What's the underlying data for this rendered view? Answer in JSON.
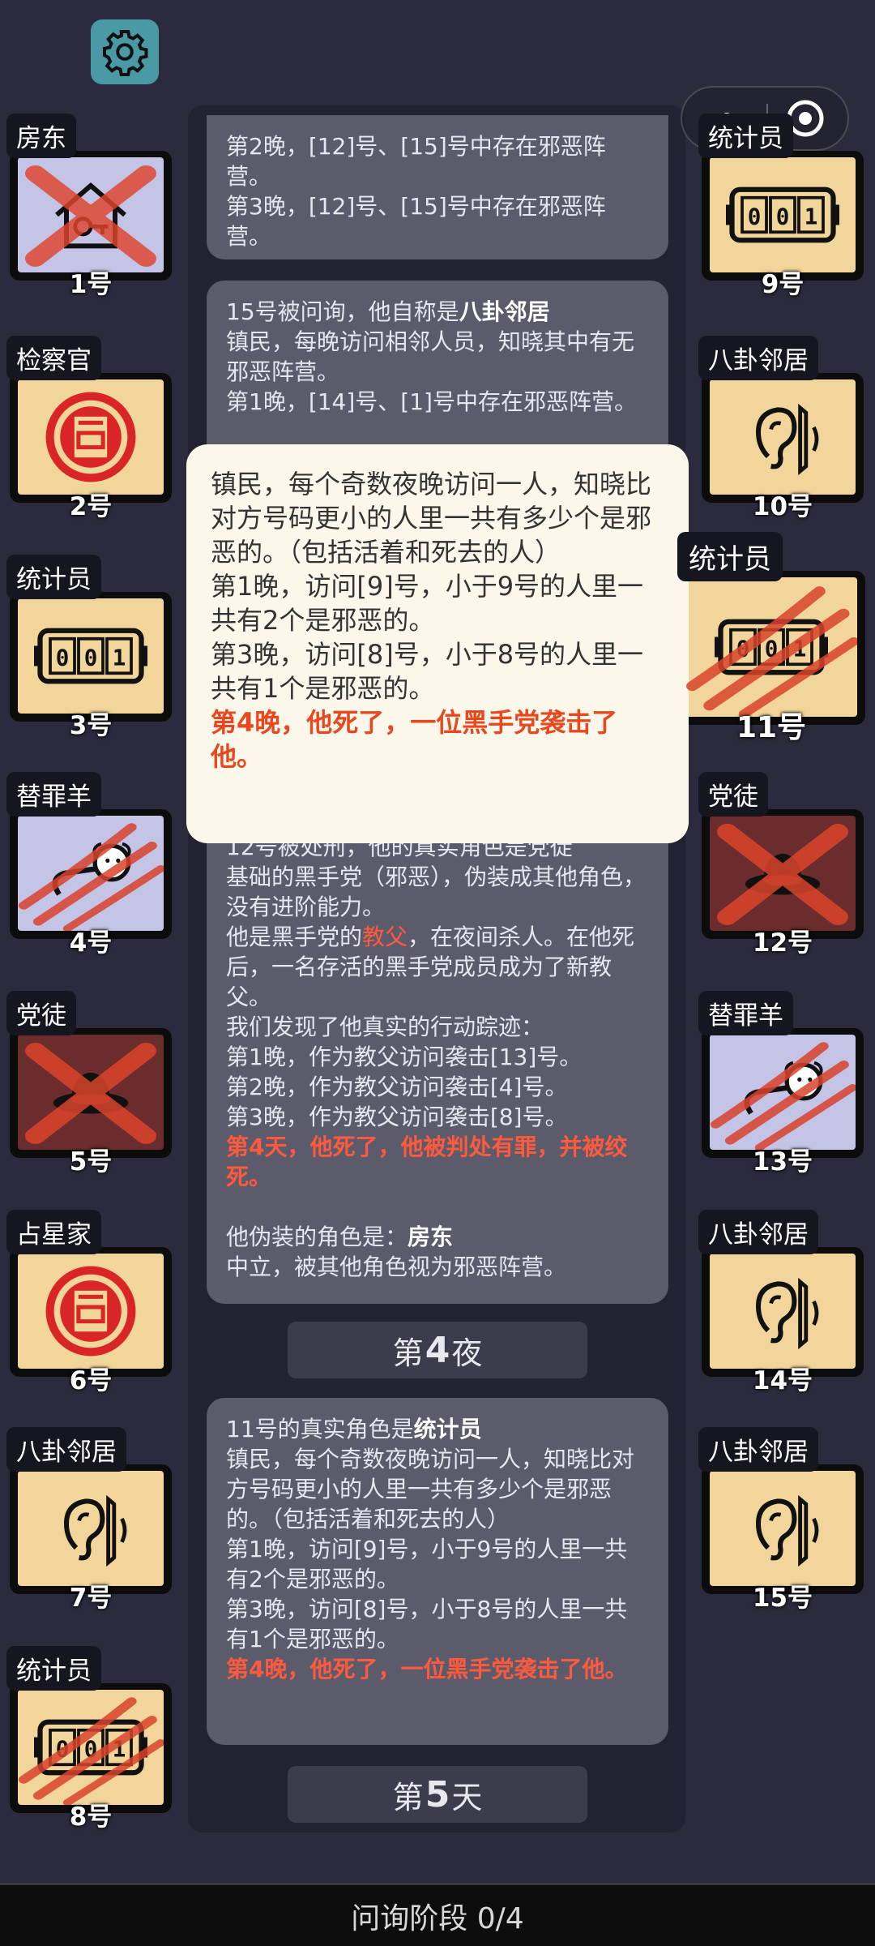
{
  "header": {
    "settings_icon": "gear-icon",
    "menu_icon": "more-dots-icon",
    "close_icon": "target-circle-icon"
  },
  "players_left": [
    {
      "role": "房东",
      "num": "1号",
      "icon": "house-key-icon",
      "state": "crossed",
      "bg": "lavender"
    },
    {
      "role": "检察官",
      "num": "2号",
      "icon": "stamp-icon",
      "state": "alive",
      "bg": "yellow"
    },
    {
      "role": "统计员",
      "num": "3号",
      "icon": "counter-icon",
      "state": "alive",
      "bg": "yellow"
    },
    {
      "role": "替罪羊",
      "num": "4号",
      "icon": "sheep-icon",
      "state": "clawed",
      "bg": "lavender"
    },
    {
      "role": "党徒",
      "num": "5号",
      "icon": "hat-icon",
      "state": "crossed",
      "bg": "dark"
    },
    {
      "role": "占星家",
      "num": "6号",
      "icon": "stamp-icon",
      "state": "alive",
      "bg": "yellow"
    },
    {
      "role": "八卦邻居",
      "num": "7号",
      "icon": "ear-icon",
      "state": "alive",
      "bg": "yellow"
    },
    {
      "role": "统计员",
      "num": "8号",
      "icon": "counter-icon",
      "state": "clawed",
      "bg": "yellow"
    }
  ],
  "players_right": [
    {
      "role": "统计员",
      "num": "9号",
      "icon": "counter-icon",
      "state": "alive",
      "bg": "yellow"
    },
    {
      "role": "八卦邻居",
      "num": "10号",
      "icon": "ear-icon",
      "state": "alive",
      "bg": "yellow"
    },
    {
      "role": "统计员",
      "num": "11号",
      "icon": "counter-icon",
      "state": "clawed",
      "bg": "yellow"
    },
    {
      "role": "党徒",
      "num": "12号",
      "icon": "hat-icon",
      "state": "crossed",
      "bg": "dark"
    },
    {
      "role": "替罪羊",
      "num": "13号",
      "icon": "sheep-icon",
      "state": "clawed",
      "bg": "lavender"
    },
    {
      "role": "八卦邻居",
      "num": "14号",
      "icon": "ear-icon",
      "state": "alive",
      "bg": "yellow"
    },
    {
      "role": "八卦邻居",
      "num": "15号",
      "icon": "ear-icon",
      "state": "alive",
      "bg": "yellow"
    }
  ],
  "log": {
    "bubble1": {
      "line1": "第2晚，[12]号、[15]号中存在邪恶阵营。",
      "line2": "第3晚，[12]号、[15]号中存在邪恶阵营。"
    },
    "bubble2": {
      "intro": "15号被问询，他自称是",
      "role": "八卦邻居",
      "desc": "镇民，每晚访问相邻人员，知晓其中有无邪恶阵营。",
      "line1": "第1晚，[14]号、[1]号中存在邪恶阵营。"
    },
    "bubble3": {
      "line0": "12号被处刑，他的真实角色是党徒",
      "desc": "基础的黑手党（邪恶），伪装成其他角色，没有进阶能力。",
      "godfather_pre": "他是黑手党的",
      "godfather": "教父",
      "godfather_post": "，在夜间杀人。在他死后，一名存活的黑手党成员成为了新教父。",
      "trace": "我们发现了他真实的行动踪迹：",
      "n1": "第1晚，作为教父访问袭击[13]号。",
      "n2": "第2晚，作为教父访问袭击[4]号。",
      "n3": "第3晚，作为教父访问袭击[8]号。",
      "death": "第4天，他死了，他被判处有罪，并被绞死。",
      "disguise_pre": "他伪装的角色是：",
      "disguise": "房东",
      "disguise_desc": "中立，被其他角色视为邪恶阵营。"
    },
    "night4": {
      "pre": "第",
      "n": "4",
      "post": "夜"
    },
    "bubble4": {
      "intro": "11号的真实角色是",
      "role": "统计员",
      "desc": "镇民，每个奇数夜晚访问一人，知晓比对方号码更小的人里一共有多少个是邪恶的。（包括活着和死去的人）",
      "n1": "第1晚，访问[9]号，小于9号的人里一共有2个是邪恶的。",
      "n3": "第3晚，访问[8]号，小于8号的人里一共有1个是邪恶的。",
      "death": "第4晚，他死了，一位黑手党袭击了他。"
    },
    "day5": {
      "pre": "第",
      "n": "5",
      "post": "天"
    }
  },
  "popup": {
    "desc": "镇民，每个奇数夜晚访问一人，知晓比对方号码更小的人里一共有多少个是邪恶的。（包括活着和死去的人）",
    "n1": "第1晚，访问[9]号，小于9号的人里一共有2个是邪恶的。",
    "n3": "第3晚，访问[8]号，小于8号的人里一共有1个是邪恶的。",
    "death": "第4晚，他死了，一位黑手党袭击了他。"
  },
  "footer": {
    "phase": "问询阶段 0/4"
  },
  "colors": {
    "accent_red": "#ff5a3d",
    "tile_yellow": "#f2d59a",
    "tile_lavender": "#c4c4e6",
    "bg": "#2b2b3d"
  }
}
